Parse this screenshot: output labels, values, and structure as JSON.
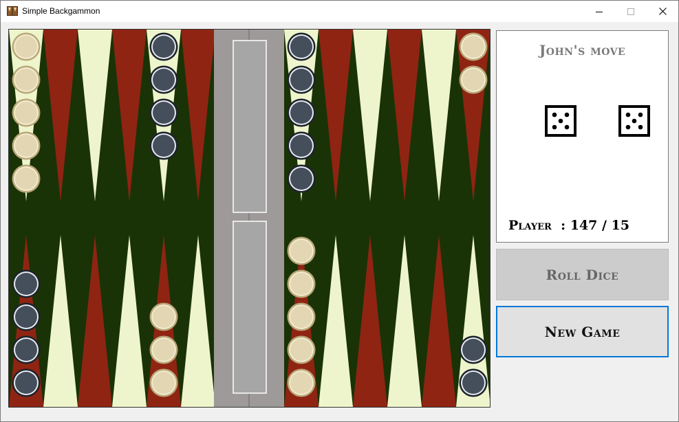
{
  "window": {
    "title": "Simple Backgammon",
    "controls": [
      "minimize",
      "maximize",
      "close"
    ]
  },
  "board": {
    "colors": {
      "felt": "#1a3306",
      "light_point": "#eef5cc",
      "red_point": "#8f2413",
      "bar": "#9d9a99",
      "bar_tray": "#a7a6a6",
      "light_checker": "#e3d7b3",
      "dark_checker": "#454f5c"
    },
    "top_points": [
      {
        "checkers": 5,
        "color": "light"
      },
      {
        "checkers": 0,
        "color": null
      },
      {
        "checkers": 0,
        "color": null
      },
      {
        "checkers": 0,
        "color": null
      },
      {
        "checkers": 4,
        "color": "dark"
      },
      {
        "checkers": 0,
        "color": null
      },
      {
        "checkers": 5,
        "color": "dark"
      },
      {
        "checkers": 0,
        "color": null
      },
      {
        "checkers": 0,
        "color": null
      },
      {
        "checkers": 0,
        "color": null
      },
      {
        "checkers": 0,
        "color": null
      },
      {
        "checkers": 2,
        "color": "light"
      }
    ],
    "bottom_points": [
      {
        "checkers": 4,
        "color": "dark"
      },
      {
        "checkers": 0,
        "color": null
      },
      {
        "checkers": 0,
        "color": null
      },
      {
        "checkers": 0,
        "color": null
      },
      {
        "checkers": 3,
        "color": "light"
      },
      {
        "checkers": 0,
        "color": null
      },
      {
        "checkers": 5,
        "color": "light"
      },
      {
        "checkers": 0,
        "color": null
      },
      {
        "checkers": 0,
        "color": null
      },
      {
        "checkers": 0,
        "color": null
      },
      {
        "checkers": 0,
        "color": null
      },
      {
        "checkers": 2,
        "color": "dark"
      }
    ]
  },
  "info": {
    "move_label": "John's move",
    "dice": [
      5,
      5
    ],
    "player_line": "Player  : 147 / 15"
  },
  "buttons": {
    "roll_dice": "Roll Dice",
    "new_game": "New Game"
  }
}
